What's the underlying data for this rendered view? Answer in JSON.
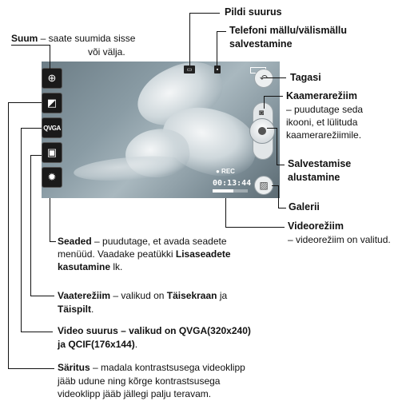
{
  "labels": {
    "pildi_suurus": "Pildi suurus",
    "telefoni_malu_1": "Telefoni mällu/välismällu",
    "telefoni_malu_2": "salvestamine",
    "suum_bold": "Suum",
    "suum_rest": " – saate suumida sisse",
    "suum_line2": "või välja.",
    "tagasi": "Tagasi",
    "kaamerareziim_bold": "Kaamerarežiim",
    "kaamerareziim_l2": "– puudutage seda",
    "kaamerareziim_l3": "ikooni, et lülituda",
    "kaamerareziim_l4": "kaamerarežiimile.",
    "salvestamise_1": "Salvestamise",
    "salvestamise_2": "alustamine",
    "galerii": "Galerii",
    "videoreziim_bold": "Videorežiim",
    "videoreziim_l2": "– videorežiim on valitud.",
    "seaded_bold": "Seaded",
    "seaded_rest": " – puudutage, et avada seadete",
    "seaded_l2a": "menüüd. Vaadake peatükki ",
    "seaded_l2b": "Lisaseadete",
    "seaded_l3a": "kasutamine",
    "seaded_l3b": " lk.",
    "vaatereziim_bold": "Vaaterežiim",
    "vaatereziim_rest": " – valikud on ",
    "vaatereziim_opt1": "Täisekraan",
    "vaatereziim_ja": " ja",
    "vaatereziim_opt2": "Täispilt",
    "vaatereziim_end": ".",
    "video_suurus_l1": "Video suurus – valikud on QVGA(320x240)",
    "video_suurus_l2a": "ja QCIF(176x144)",
    "video_suurus_l2b": ".",
    "saritus_bold": "Säritus",
    "saritus_rest": " – madala kontrastsusega videoklipp",
    "saritus_l2": "jääb udune ning kõrge kontrastsusega",
    "saritus_l3": "videoklipp jääb jällegi palju teravam."
  },
  "screen": {
    "qvga_label": "QVGA",
    "rec_label": "● REC",
    "timer": "00:13:44",
    "recording_progress": 0.6
  },
  "icons": [
    "zoom-icon",
    "exposure-icon",
    "video-size-icon",
    "view-mode-icon",
    "settings-gear-icon",
    "back-icon",
    "camera-mode-icon",
    "record-button",
    "gallery-icon",
    "storage-icon",
    "image-size-icon",
    "battery-icon"
  ]
}
